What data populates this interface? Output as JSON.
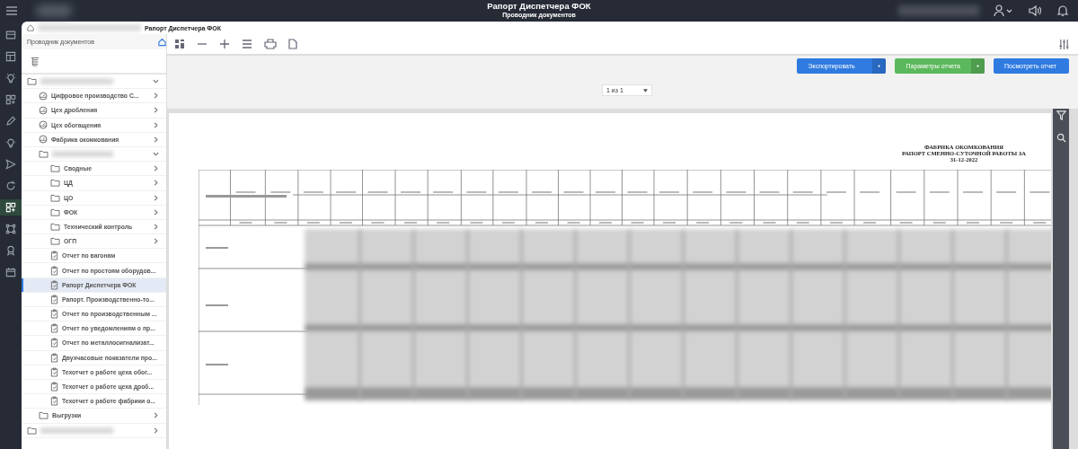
{
  "header": {
    "title": "Рапорт Диспетчера ФОК",
    "subtitle": "Проводник документов"
  },
  "rail": [
    {
      "selected": false
    },
    {
      "selected": false
    },
    {
      "selected": false
    },
    {
      "selected": false
    },
    {
      "selected": false
    },
    {
      "selected": false
    },
    {
      "selected": false
    },
    {
      "selected": false
    },
    {
      "selected": true
    },
    {
      "selected": false
    },
    {
      "selected": false
    },
    {
      "selected": false
    }
  ],
  "breadcrumb": {
    "current": "Рапорт Диспетчера ФОК"
  },
  "sidebar": {
    "title": "Проводник документов",
    "tree": [
      {
        "kind": "folder",
        "expanded": true,
        "selected": false,
        "children": [
          {
            "kind": "dashboard",
            "label": "Цифровое производство С...",
            "expanded": false,
            "selected": false
          },
          {
            "kind": "dashboard",
            "label": "Цех дробления",
            "expanded": false,
            "selected": false
          },
          {
            "kind": "dashboard",
            "label": "Цех обогащения",
            "expanded": false,
            "selected": false
          },
          {
            "kind": "dashboard",
            "label": "Фабрика окомкования",
            "expanded": false,
            "selected": false
          },
          {
            "kind": "folder",
            "expanded": true,
            "selected": false,
            "children": [
              {
                "kind": "folder",
                "label": "Сводные",
                "expanded": false,
                "selected": false
              },
              {
                "kind": "folder",
                "label": "ЦД",
                "expanded": false,
                "selected": false
              },
              {
                "kind": "folder",
                "label": "ЦО",
                "expanded": false,
                "selected": false
              },
              {
                "kind": "folder",
                "label": "ФОК",
                "expanded": false,
                "selected": false
              },
              {
                "kind": "folder",
                "label": "Технический контроль",
                "expanded": false,
                "selected": false
              },
              {
                "kind": "folder",
                "label": "ОГП",
                "expanded": false,
                "selected": false
              },
              {
                "kind": "report",
                "label": "Отчет по вагонам",
                "selected": false
              },
              {
                "kind": "report",
                "label": "Отчет по простоям оборудов...",
                "selected": false
              },
              {
                "kind": "report",
                "label": "Рапорт Диспетчера ФОК",
                "selected": true
              },
              {
                "kind": "report",
                "label": "Рапорт. Производственно-то...",
                "selected": false
              },
              {
                "kind": "report",
                "label": "Отчет по производственным ...",
                "selected": false
              },
              {
                "kind": "report",
                "label": "Отчет по уведомлениям о пр...",
                "selected": false
              },
              {
                "kind": "report",
                "label": "Отчет по металлосигнализат...",
                "selected": false
              },
              {
                "kind": "report",
                "label": "Двухчасовые показатели про...",
                "selected": false
              },
              {
                "kind": "report",
                "label": "Техотчет о работе цеха обог...",
                "selected": false
              },
              {
                "kind": "report",
                "label": "Техотчет о работе цеха дроб...",
                "selected": false
              },
              {
                "kind": "report",
                "label": "Техотчет о работе фабрики о...",
                "selected": false
              }
            ]
          },
          {
            "kind": "folder",
            "label": "Выгрузки",
            "expanded": false,
            "selected": false
          }
        ]
      },
      {
        "kind": "folder",
        "expanded": false,
        "selected": false
      }
    ]
  },
  "actions": [
    {
      "label": "Экспортировать",
      "kind": "split",
      "color": "#2f7be0"
    },
    {
      "label": "Параметры отчета",
      "kind": "split",
      "color": "#5cb85c"
    },
    {
      "label": "Посмотреть отчет",
      "kind": "plain",
      "color": "#2f7be0"
    }
  ],
  "pager": {
    "value": "1 из 1"
  },
  "report": {
    "title_lines": [
      "ФАБРИКА ОКОМКОВАНИЯ",
      "РАПОРТ СМЕННО-СУТОЧНОЙ РАБОТЫ ЗА",
      "31-12-2022"
    ]
  }
}
